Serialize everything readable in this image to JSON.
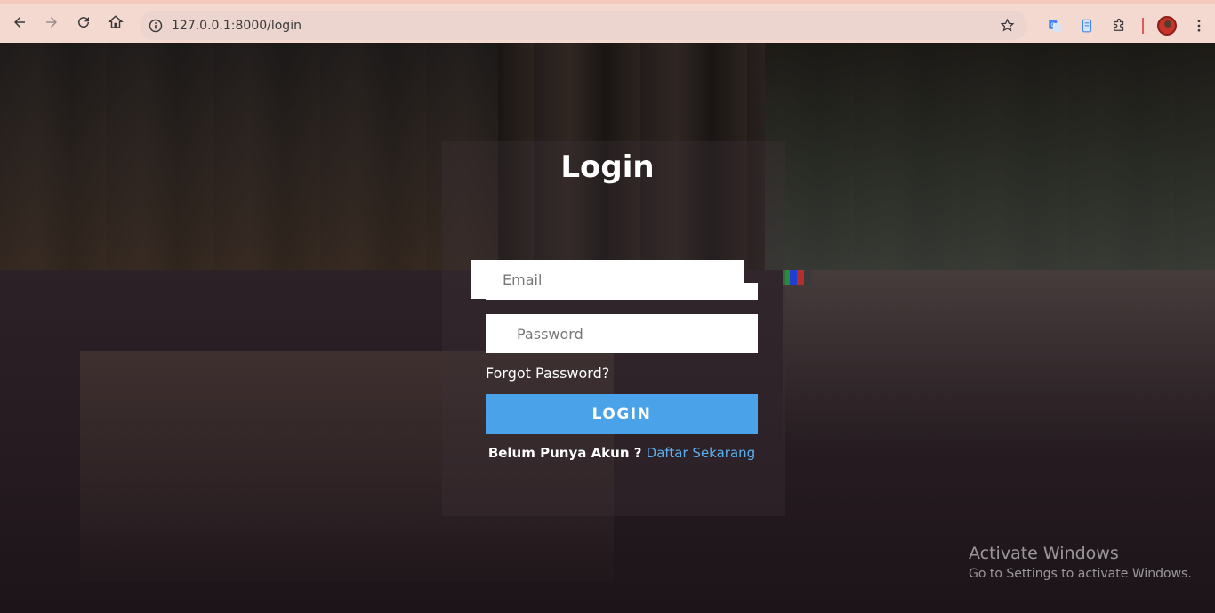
{
  "browser": {
    "url": "127.0.0.1:8000/login",
    "icons": [
      "back-icon",
      "forward-icon",
      "reload-icon",
      "home-icon",
      "site-info-icon",
      "bookmark-star-icon",
      "google-translate-icon",
      "reading-mode-icon",
      "extensions-icon",
      "profile-avatar",
      "more-menu-icon"
    ]
  },
  "login": {
    "title": "Login",
    "email_placeholder": "Email",
    "password_placeholder": "Password",
    "forgot_label": "Forgot Password?",
    "button_label": "LOGIN",
    "register_prompt": "Belum Punya Akun ?",
    "register_link": "Daftar Sekarang"
  },
  "watermark": {
    "title": "Activate Windows",
    "subtitle": "Go to Settings to activate Windows."
  },
  "colors": {
    "accent": "#4aa3e8",
    "link": "#5ab0f0",
    "browser_bar": "#f4d9d0"
  }
}
